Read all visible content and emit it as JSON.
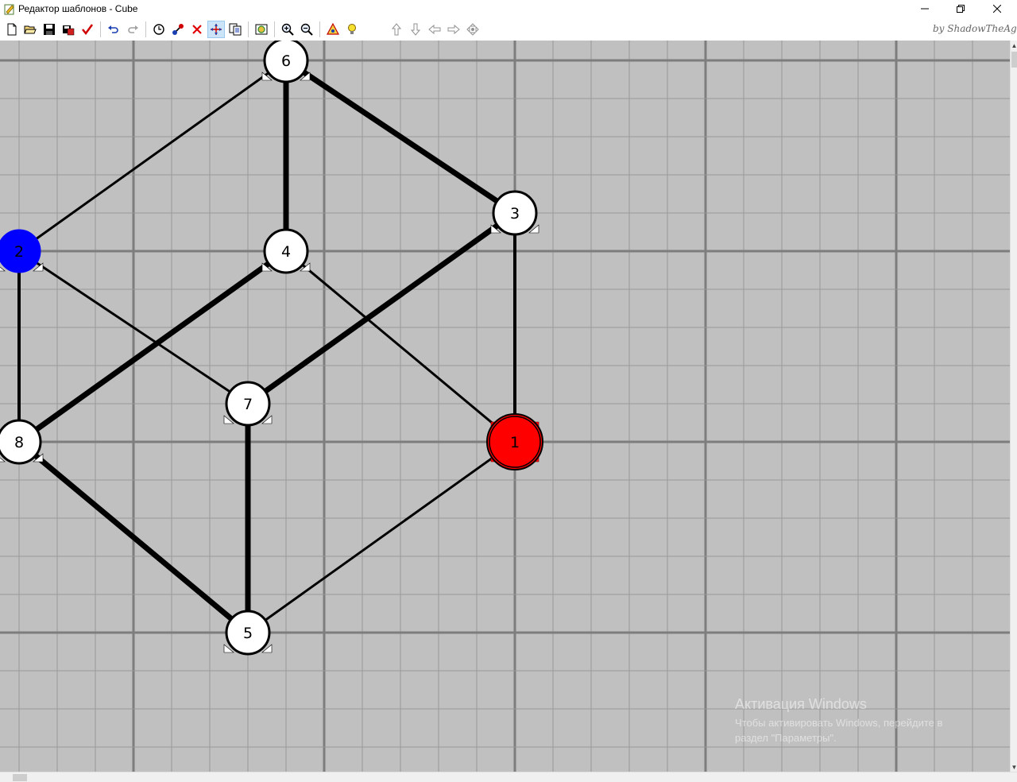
{
  "window": {
    "title": "Редактор шаблонов - Cube",
    "controls": [
      "minimize",
      "restore",
      "close"
    ]
  },
  "toolbar": {
    "signature": "by ShadowTheAge",
    "buttons": [
      {
        "name": "new-file-icon"
      },
      {
        "name": "open-folder-icon"
      },
      {
        "name": "save-icon"
      },
      {
        "name": "save-as-icon"
      },
      {
        "name": "check-icon"
      },
      {
        "name": "undo-icon"
      },
      {
        "name": "redo-icon"
      },
      {
        "name": "add-vertex-icon"
      },
      {
        "name": "add-edge-icon"
      },
      {
        "name": "delete-icon"
      },
      {
        "name": "move-icon",
        "active": true
      },
      {
        "name": "copy-icon"
      },
      {
        "name": "picture-icon"
      },
      {
        "name": "zoom-in-icon"
      },
      {
        "name": "zoom-out-icon"
      },
      {
        "name": "warning-icon"
      },
      {
        "name": "lightbulb-icon"
      },
      {
        "name": "arrow-up-icon"
      },
      {
        "name": "arrow-down-icon"
      },
      {
        "name": "arrow-left-icon"
      },
      {
        "name": "arrow-right-icon"
      },
      {
        "name": "center-icon"
      }
    ]
  },
  "graph": {
    "nodes": [
      {
        "id": "1",
        "label": "1",
        "fill": "#ff0000",
        "state": "selected"
      },
      {
        "id": "2",
        "label": "2",
        "fill": "#0000ff",
        "state": "highlighted"
      },
      {
        "id": "3",
        "label": "3",
        "fill": "#ffffff"
      },
      {
        "id": "4",
        "label": "4",
        "fill": "#ffffff"
      },
      {
        "id": "5",
        "label": "5",
        "fill": "#ffffff"
      },
      {
        "id": "6",
        "label": "6",
        "fill": "#ffffff"
      },
      {
        "id": "7",
        "label": "7",
        "fill": "#ffffff"
      },
      {
        "id": "8",
        "label": "8",
        "fill": "#ffffff"
      }
    ],
    "edges": [
      {
        "from": "6",
        "to": "4",
        "weight": "thick"
      },
      {
        "from": "6",
        "to": "3",
        "weight": "thick"
      },
      {
        "from": "6",
        "to": "2",
        "weight": "thin"
      },
      {
        "from": "3",
        "to": "7",
        "weight": "thick"
      },
      {
        "from": "3",
        "to": "1",
        "weight": "medium"
      },
      {
        "from": "4",
        "to": "8",
        "weight": "thick"
      },
      {
        "from": "4",
        "to": "1",
        "weight": "thin"
      },
      {
        "from": "2",
        "to": "7",
        "weight": "thin"
      },
      {
        "from": "2",
        "to": "8",
        "weight": "medium"
      },
      {
        "from": "7",
        "to": "5",
        "weight": "thick"
      },
      {
        "from": "8",
        "to": "5",
        "weight": "thick"
      },
      {
        "from": "1",
        "to": "5",
        "weight": "thin"
      }
    ],
    "colors": {
      "background": "#c0c0c0",
      "grid_minor": "#999999",
      "grid_major": "#7d7d7d",
      "edge": "#000000",
      "selected_node": "#ff0000",
      "highlighted_node": "#0000ff"
    }
  },
  "watermark": {
    "title": "Активация Windows",
    "text": "Чтобы активировать Windows, перейдите в раздел \"Параметры\"."
  }
}
